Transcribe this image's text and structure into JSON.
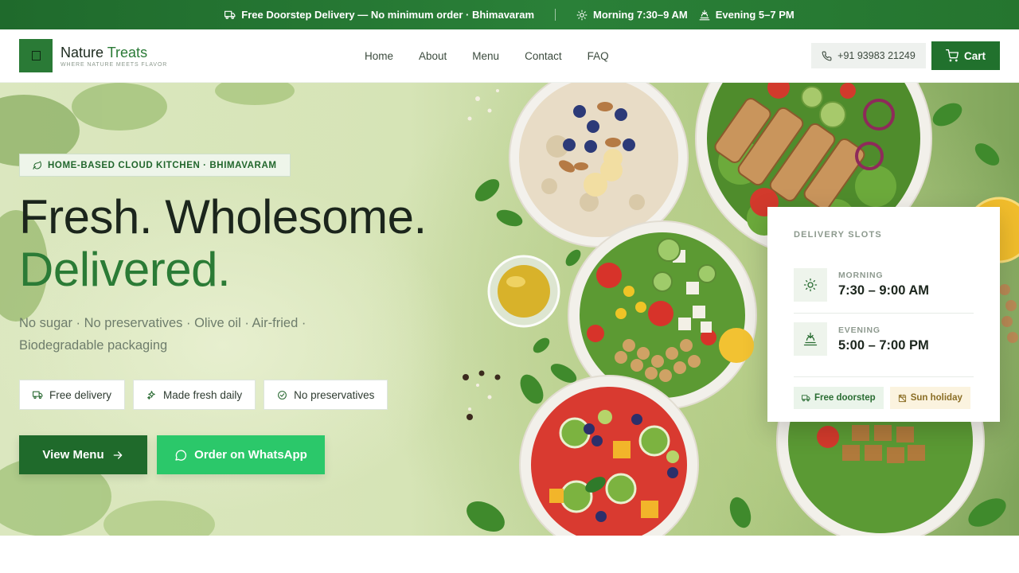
{
  "topbar": {
    "delivery": "Free Doorstep Delivery — No minimum order · Bhimavaram",
    "morning": "Morning 7:30–9 AM",
    "evening": "Evening 5–7 PM"
  },
  "header": {
    "brand_first": "Nature",
    "brand_second": "Treats",
    "tagline": "WHERE NATURE MEETS FLAVOR",
    "nav": [
      "Home",
      "About",
      "Menu",
      "Contact",
      "FAQ"
    ],
    "phone": "+91 93983 21249",
    "cart_label": "Cart"
  },
  "hero": {
    "badge": "HOME-BASED CLOUD KITCHEN · BHIMAVARAM",
    "headline_1": "Fresh. Wholesome.",
    "headline_2": "Delivered.",
    "subtitle": "No sugar · No preservatives · Olive oil · Air-fried · Biodegradable packaging",
    "chips": [
      "Free delivery",
      "Made fresh daily",
      "No preservatives"
    ],
    "btn_menu": "View Menu",
    "btn_whatsapp": "Order on WhatsApp"
  },
  "slots": {
    "title": "DELIVERY SLOTS",
    "morning_label": "MORNING",
    "morning_time": "7:30 – 9:00 AM",
    "evening_label": "EVENING",
    "evening_time": "5:00 – 7:00 PM",
    "tag_free": "Free doorstep",
    "tag_holiday": "Sun holiday"
  },
  "colors": {
    "brand_green": "#21712d",
    "whatsapp_green": "#2bc86a",
    "accent_text": "#2b7b36"
  }
}
